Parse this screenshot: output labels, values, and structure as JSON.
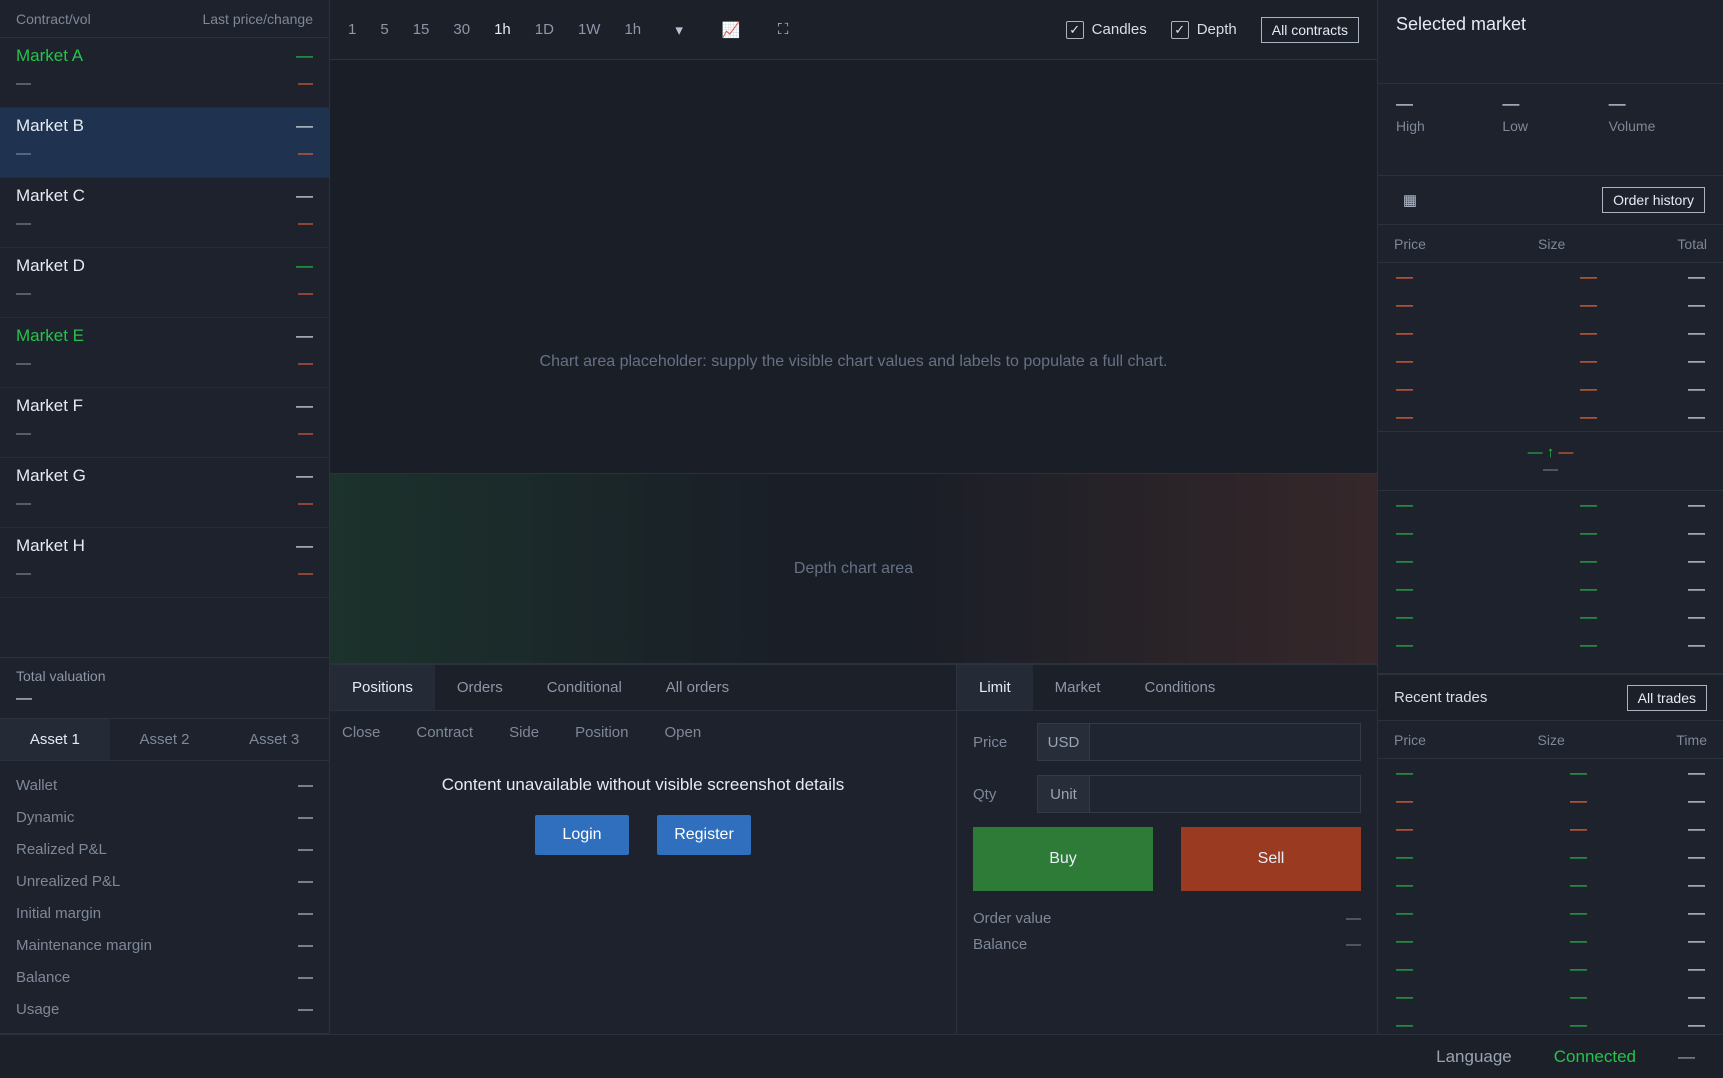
{
  "markets": {
    "header_contract": "Contract/vol",
    "header_price": "Last price/change",
    "items": [
      {
        "symbol": "Market A",
        "volume": "—",
        "price": "—",
        "change": "—"
      },
      {
        "symbol": "Market B",
        "volume": "—",
        "price": "—",
        "change": "—"
      },
      {
        "symbol": "Market C",
        "volume": "—",
        "price": "—",
        "change": "—"
      },
      {
        "symbol": "Market D",
        "volume": "—",
        "price": "—",
        "change": "—"
      },
      {
        "symbol": "Market E",
        "volume": "—",
        "price": "—",
        "change": "—"
      },
      {
        "symbol": "Market F",
        "volume": "—",
        "price": "—",
        "change": "—"
      },
      {
        "symbol": "Market G",
        "volume": "—",
        "price": "—",
        "change": "—"
      },
      {
        "symbol": "Market H",
        "volume": "—",
        "price": "—",
        "change": "—"
      }
    ]
  },
  "portfolio": {
    "title": "Total valuation",
    "value": "—",
    "tabs": [
      "Asset 1",
      "Asset 2",
      "Asset 3"
    ],
    "rows": [
      {
        "label": "Wallet",
        "value": "—"
      },
      {
        "label": "Dynamic",
        "value": "—"
      },
      {
        "label": "Realized P&L",
        "value": "—"
      },
      {
        "label": "Unrealized P&L",
        "value": "—"
      },
      {
        "label": "Initial margin",
        "value": "—"
      },
      {
        "label": "Maintenance margin",
        "value": "—"
      },
      {
        "label": "Balance",
        "value": "—"
      },
      {
        "label": "Usage",
        "value": "—"
      }
    ]
  },
  "toolbar": {
    "intervals": [
      "1",
      "5",
      "15",
      "30",
      "1h",
      "1D",
      "1W"
    ],
    "selected_interval": "1h",
    "candles_label": "Candles",
    "depth_label": "Depth",
    "all_contracts_label": "All contracts"
  },
  "chart": {
    "placeholder": "Chart area placeholder: supply the visible chart values and labels to populate a full chart.",
    "depth_placeholder": "Depth chart area"
  },
  "positions": {
    "tabs": [
      "Positions",
      "Orders",
      "Conditional",
      "All orders"
    ],
    "columns": [
      "Close",
      "Contract",
      "Side",
      "Position",
      "Open"
    ],
    "notice": "Content unavailable without visible screenshot details",
    "login_label": "Login",
    "register_label": "Register"
  },
  "order_form": {
    "tabs": [
      "Limit",
      "Market",
      "Conditions"
    ],
    "price_label": "Price",
    "price_prefix": "USD",
    "price_value": "",
    "quantity_label": "Qty",
    "quantity_prefix": "Unit",
    "quantity_value": "",
    "buy_label": "Buy",
    "buy_subtitle": "",
    "sell_label": "Sell",
    "sell_subtitle": "",
    "order_value_label": "Order value",
    "order_value": "—",
    "balance_label": "Balance",
    "balance_value": "—"
  },
  "ticker": {
    "title": "Selected market",
    "stats": [
      {
        "value": "—",
        "label": "High"
      },
      {
        "value": "—",
        "label": "Low"
      },
      {
        "value": "—",
        "label": "Volume"
      }
    ],
    "book_history_label": "Order history"
  },
  "order_book": {
    "headers": [
      "Price",
      "Size",
      "Total"
    ],
    "asks": [
      [
        "—",
        "—",
        "—"
      ],
      [
        "—",
        "—",
        "—"
      ],
      [
        "—",
        "—",
        "—"
      ],
      [
        "—",
        "—",
        "—"
      ],
      [
        "—",
        "—",
        "—"
      ],
      [
        "—",
        "—",
        "—"
      ]
    ],
    "mid_price": "—",
    "mid_change": "—",
    "mid_sub": "—",
    "bids": [
      [
        "—",
        "—",
        "—"
      ],
      [
        "—",
        "—",
        "—"
      ],
      [
        "—",
        "—",
        "—"
      ],
      [
        "—",
        "—",
        "—"
      ],
      [
        "—",
        "—",
        "—"
      ],
      [
        "—",
        "—",
        "—"
      ]
    ]
  },
  "trades": {
    "title": "Recent trades",
    "all_label": "All trades",
    "headers": [
      "Price",
      "Size",
      "Time"
    ],
    "rows": [
      [
        "—",
        "—",
        "—"
      ],
      [
        "—",
        "—",
        "—"
      ],
      [
        "—",
        "—",
        "—"
      ],
      [
        "—",
        "—",
        "—"
      ],
      [
        "—",
        "—",
        "—"
      ],
      [
        "—",
        "—",
        "—"
      ],
      [
        "—",
        "—",
        "—"
      ],
      [
        "—",
        "—",
        "—"
      ],
      [
        "—",
        "—",
        "—"
      ],
      [
        "—",
        "—",
        "—"
      ]
    ]
  },
  "footer": {
    "language": "Language",
    "connection": "Connected",
    "timestamp": "—"
  }
}
